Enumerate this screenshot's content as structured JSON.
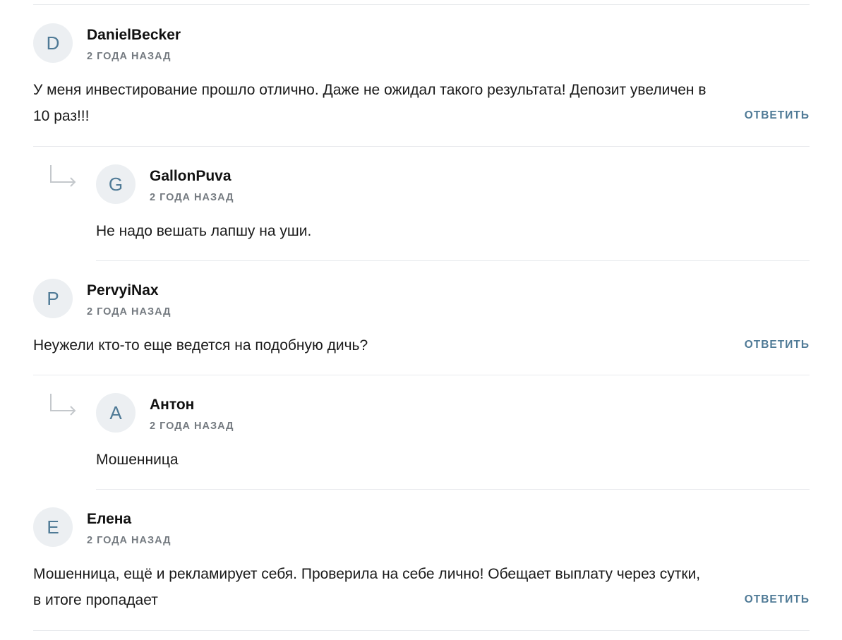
{
  "comments": [
    {
      "initial": "D",
      "author": "DanielBecker",
      "date": "2 ГОДА НАЗАД",
      "text": "У меня инвестирование прошло отлично. Даже не ожидал такого результата! Депозит увеличен в 10 раз!!!",
      "reply_label": "ОТВЕТИТЬ"
    },
    {
      "initial": "G",
      "author": "GallonPuva",
      "date": "2 ГОДА НАЗАД",
      "text": "Не надо вешать лапшу на уши."
    },
    {
      "initial": "P",
      "author": "PervyiNax",
      "date": "2 ГОДА НАЗАД",
      "text": "Неужели кто-то еще ведется на подобную дичь?",
      "reply_label": "ОТВЕТИТЬ"
    },
    {
      "initial": "А",
      "author": "Антон",
      "date": "2 ГОДА НАЗАД",
      "text": "Мошенница"
    },
    {
      "initial": "Е",
      "author": "Елена",
      "date": "2 ГОДА НАЗАД",
      "text": "Мошенница, ещё и рекламирует себя. Проверила на себе лично! Обещает выплату через сутки, в итоге пропадает",
      "reply_label": "ОТВЕТИТЬ"
    }
  ]
}
